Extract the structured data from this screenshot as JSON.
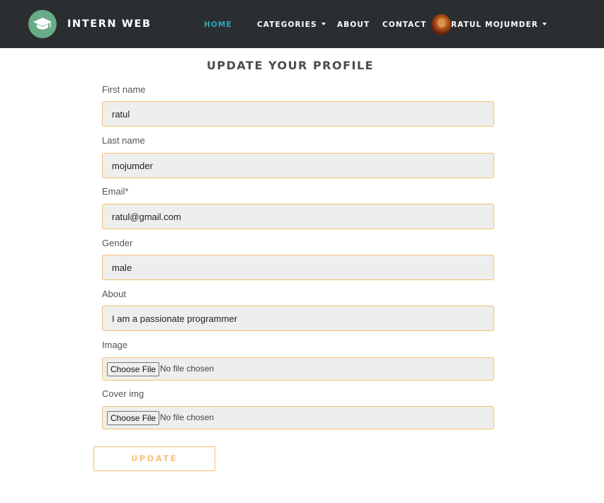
{
  "navbar": {
    "brand": "INTERN WEB",
    "logo_icon": "graduation-cap-icon",
    "links": {
      "home": "HOME",
      "categories": "CATEGORIES",
      "about": "ABOUT",
      "contact": "CONTACT"
    },
    "user_name": "RATUL MOJUMDER",
    "active_color": "#2aa7bf",
    "background": "#2b2e31"
  },
  "form": {
    "title": "UPDATE YOUR PROFILE",
    "first_name": {
      "label": "First name",
      "value": "ratul"
    },
    "last_name": {
      "label": "Last name",
      "value": "mojumder"
    },
    "email": {
      "label": "Email*",
      "value": "ratul@gmail.com"
    },
    "gender": {
      "label": "Gender",
      "value": "male"
    },
    "about": {
      "label": "About",
      "value": "I am a passionate programmer"
    },
    "image": {
      "label": "Image",
      "button": "Choose File",
      "status": "No file chosen"
    },
    "cover": {
      "label": "Cover img",
      "button": "Choose File",
      "status": "No file chosen"
    },
    "submit": "UPDATE",
    "accent_color": "#f5c06e",
    "field_background": "#eeeeee"
  }
}
